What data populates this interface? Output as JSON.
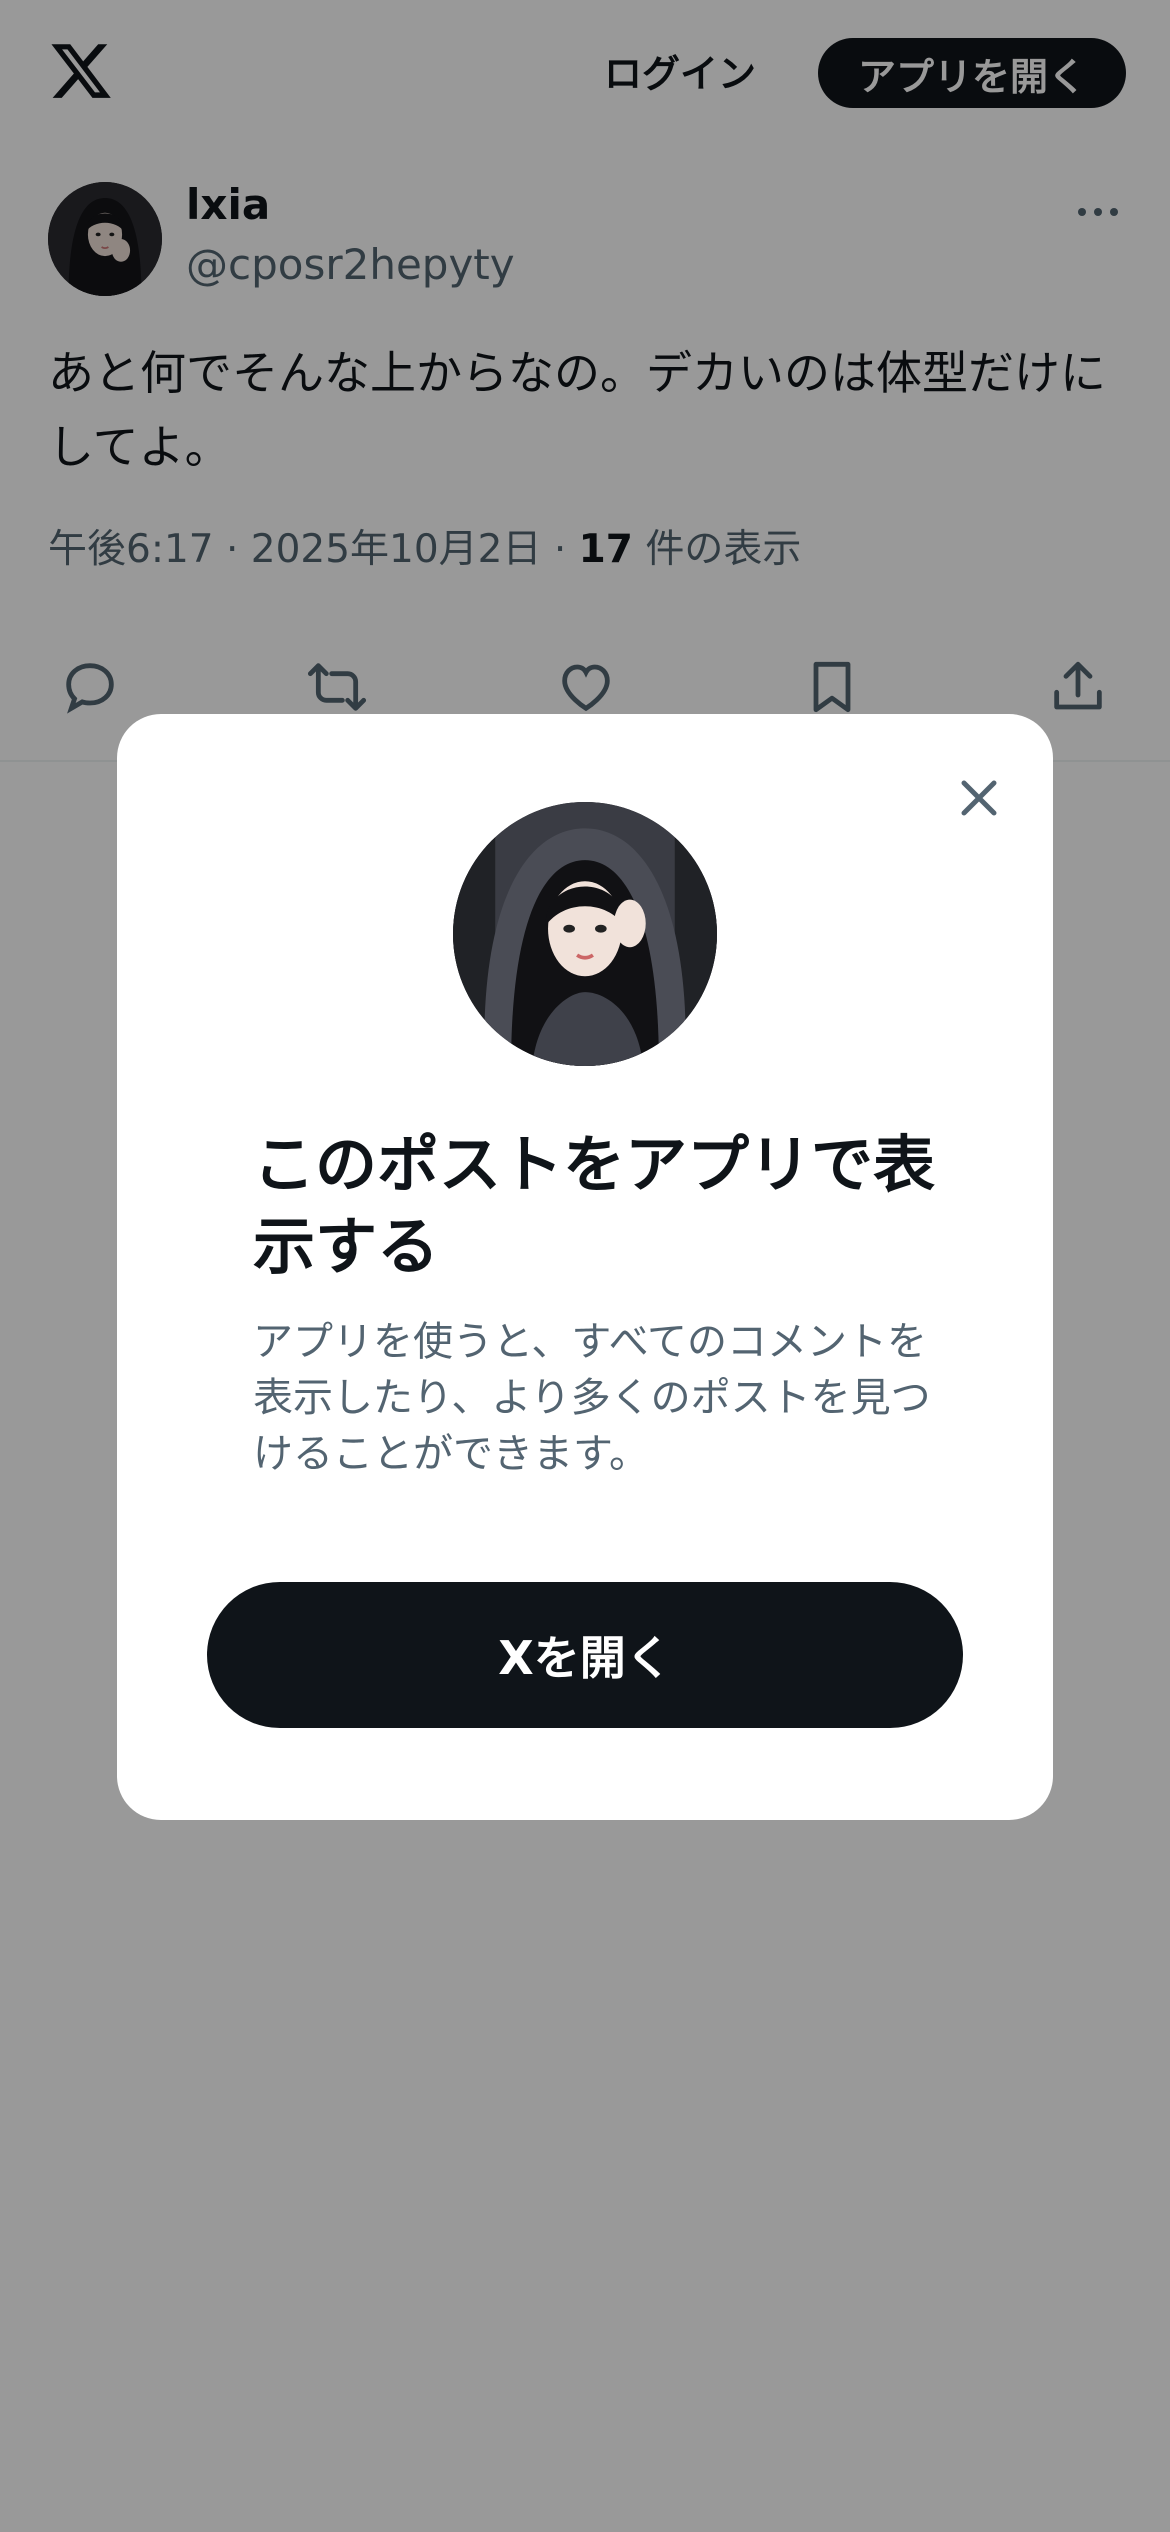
{
  "header": {
    "logo_icon": "x-logo-icon",
    "login_label": "ログイン",
    "open_app_label": "アプリを開く"
  },
  "post": {
    "author_name": "lxia",
    "author_handle": "@cposr2hepyty",
    "text": "あと何でそんな上からなの。デカいのは体型だけにしてよ。",
    "meta_prefix": "午後6:17 · 2025年10月2日 · ",
    "view_count": "17",
    "view_suffix": " 件の表示",
    "actions": [
      "reply-icon",
      "repost-icon",
      "like-icon",
      "bookmark-icon",
      "share-icon"
    ]
  },
  "modal": {
    "title": "このポストをアプリで表示する",
    "description": "アプリを使うと、すべてのコメントを表示したり、より多くのポストを見つけることができます。",
    "open_button_label": "Xを開く",
    "close_icon": "close-icon"
  },
  "colors": {
    "text_primary": "#0f1419",
    "text_secondary": "#536471",
    "button_dark": "#0f1419",
    "overlay": "rgba(0,0,0,0.40)"
  }
}
